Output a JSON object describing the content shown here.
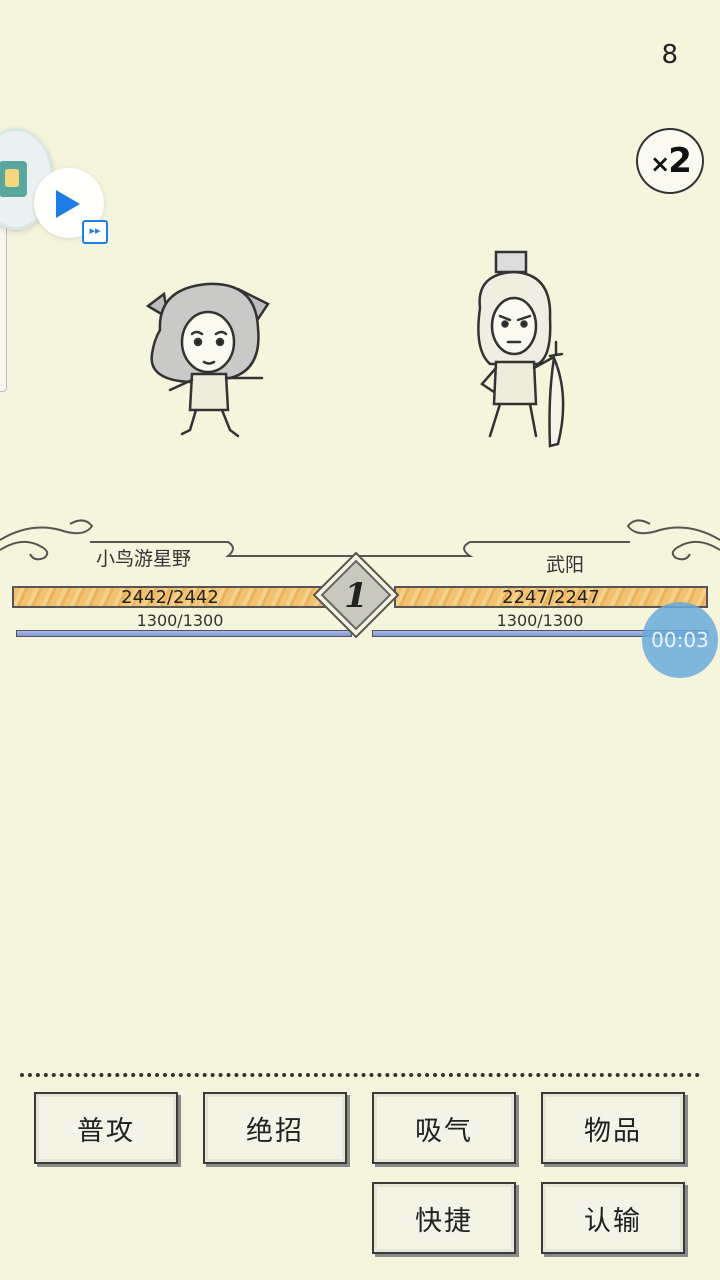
{
  "hud": {
    "turn_counter": "8",
    "speed": {
      "prefix": "×",
      "value": "2"
    },
    "round": "1",
    "timer": "00:03"
  },
  "player": {
    "name": "小鸟游星野",
    "hp": "2442/2442",
    "mp": "1300/1300",
    "hp_fraction": 1,
    "mp_fraction": 1
  },
  "enemy": {
    "name": "武阳",
    "hp": "2247/2247",
    "mp": "1300/1300",
    "hp_fraction": 1,
    "mp_fraction": 1
  },
  "actions": {
    "attack": "普攻",
    "ultimate": "绝招",
    "absorb": "吸气",
    "items": "物品",
    "quick": "快捷",
    "surrender": "认输"
  },
  "overlay": {
    "fast_forward_icon": "fast-forward-icon",
    "play_icon": "play-icon"
  }
}
